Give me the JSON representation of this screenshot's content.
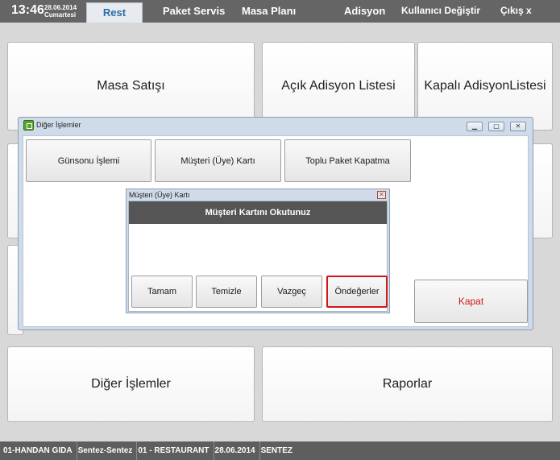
{
  "topbar": {
    "clock": "13:46",
    "date": "28.06.2014",
    "day": "Cumartesi",
    "tabs": [
      "Rest",
      "Paket Servis",
      "Masa Planı",
      "Adisyon"
    ],
    "change_user": "Kullanıcı Değiştir",
    "logout": "Çıkış",
    "close_symbol": "x"
  },
  "tiles": {
    "masa_satisi": "Masa Satışı",
    "acik_adisyon": "Açık Adisyon Listesi",
    "kapali_adisyon": "Kapalı AdisyonListesi",
    "diger_islemler": "Diğer İşlemler",
    "raporlar": "Raporlar"
  },
  "window": {
    "title": "Diğer İşlemler",
    "buttons": [
      "Günsonu İşlemi",
      "Müşteri (Üye) Kartı",
      "Toplu Paket Kapatma"
    ],
    "close_button": "Kapat",
    "controls": [
      "▁",
      "▢",
      "✕"
    ]
  },
  "dialog": {
    "title": "Müşteri (Üye) Kartı",
    "close_symbol": "✕",
    "header": "Müşteri Kartını Okutunuz",
    "buttons": [
      "Tamam",
      "Temizle",
      "Vazgeç",
      "Öndeğerler"
    ]
  },
  "footer": [
    "01-HANDAN GIDA",
    "Sentez-Sentez",
    "01 - RESTAURANT",
    "28.06.2014",
    "SENTEZ"
  ],
  "colors": {
    "accent_tab": "#2a6fa8",
    "close_text": "#d11818",
    "highlight_border": "#d11818"
  }
}
